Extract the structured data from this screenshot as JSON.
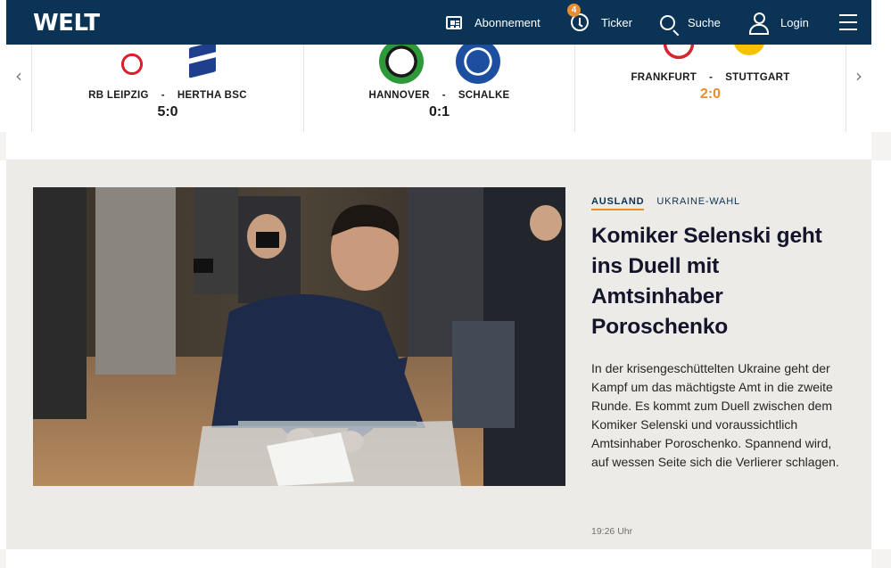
{
  "header": {
    "brand": "WELT",
    "nav": {
      "abonnement": "Abonnement",
      "ticker": "Ticker",
      "ticker_badge": "4",
      "suche": "Suche",
      "login": "Login"
    },
    "colors": {
      "background": "#0b3355",
      "badge": "#e88e2d"
    }
  },
  "scores": {
    "prev_icon": "chevron-left-icon",
    "next_icon": "chevron-right-icon",
    "matches": [
      {
        "home": "RB LEIPZIG",
        "separator": "-",
        "away": "HERTHA BSC",
        "result": "5:0",
        "live": false,
        "home_logo": "rb-leipzig-logo",
        "away_logo": "hertha-bsc-logo"
      },
      {
        "home": "HANNOVER",
        "separator": "-",
        "away": "SCHALKE",
        "result": "0:1",
        "live": false,
        "home_logo": "hannover-96-logo",
        "away_logo": "schalke-04-logo"
      },
      {
        "home": "FRANKFURT",
        "separator": "-",
        "away": "STUTTGART",
        "result": "2:0",
        "live": true,
        "home_logo": "eintracht-frankfurt-logo",
        "away_logo": "vfb-stuttgart-logo"
      }
    ]
  },
  "article": {
    "topic": "AUSLAND",
    "subtopic": "UKRAINE-WAHL",
    "headline": "Komiker Selenski geht ins Duell mit Amtsinhaber Poroschenko",
    "lead": "In der krisengeschüttelten Ukraine geht der Kampf um das mächtigste Amt in die zweite Runde. Es kommt zum Duell zwischen dem Komiker Selenski und voraussichtlich Amtsinhaber Poroschenko. Spannend wird, auf wessen Seite sich die Verlierer schlagen.",
    "timestamp": "19:26 Uhr",
    "image": "photo-man-casting-ballot"
  }
}
